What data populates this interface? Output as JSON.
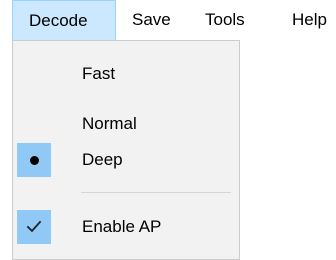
{
  "menubar": {
    "items": [
      {
        "label": "Decode",
        "active": true
      },
      {
        "label": "Save"
      },
      {
        "label": "Tools"
      },
      {
        "label": "Help"
      }
    ]
  },
  "decode_menu": {
    "items": [
      {
        "label": "Fast",
        "state": "unchecked"
      },
      {
        "label": "Normal",
        "state": "unchecked"
      },
      {
        "label": "Deep",
        "state": "radio-selected",
        "indicator_icon": "bullet-icon"
      },
      {
        "label": "Enable AP",
        "state": "checked",
        "indicator_icon": "checkmark-icon"
      }
    ]
  },
  "colors": {
    "menubar_active_bg": "#cce8ff",
    "menu_bg": "#f2f2f2",
    "checked_indicator_bg": "#90c8f6"
  }
}
